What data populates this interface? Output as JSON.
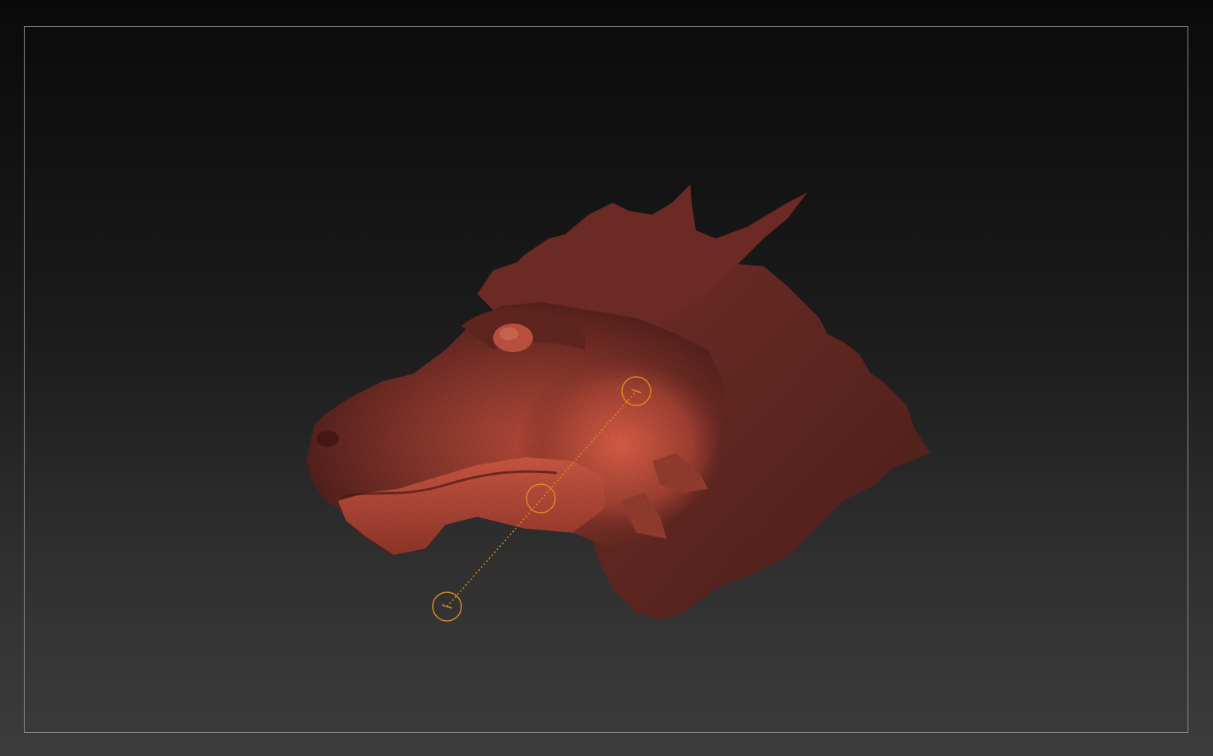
{
  "viewport": {
    "background_top": "#0a0a0a",
    "background_bottom": "#3c3c3c",
    "frame_color": "#8a8a8a"
  },
  "model": {
    "subject": "dragon-head-sculpt",
    "material_color": "#7a3028",
    "highlight_color": "#c4503c"
  },
  "gizmo": {
    "icon": "transpose-line-icon",
    "color": "#e08a1e"
  }
}
